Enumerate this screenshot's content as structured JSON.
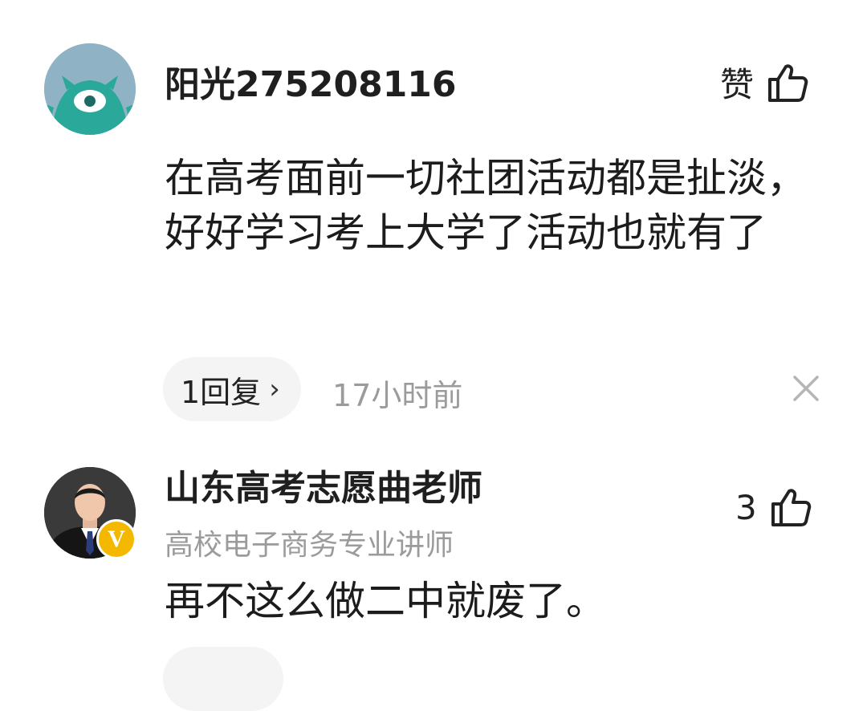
{
  "comments": [
    {
      "username": "阳光275208116",
      "like_label": "赞",
      "text": "在高考面前一切社团活动都是扯淡，好好学习考上大学了活动也就有了",
      "reply_label": "1回复",
      "reply_chevron": "›",
      "time": "17小时前",
      "icons": {
        "like": "thumbs-up-icon",
        "close": "close-icon",
        "avatar": "monster-avatar"
      }
    },
    {
      "username": "山东高考志愿曲老师",
      "subtitle": "高校电子商务专业讲师",
      "like_count": "3",
      "badge_label": "V",
      "text": "再不这么做二中就废了。",
      "icons": {
        "like": "thumbs-up-icon",
        "avatar": "person-photo-avatar",
        "badge": "verified-v-badge"
      }
    }
  ],
  "colors": {
    "secondary_text": "#9b9b9b",
    "pill_bg": "#f4f4f4",
    "verified_badge": "#f5b800",
    "avatar1_bg": "#8fb3c4",
    "avatar1_creature": "#2aa89a"
  }
}
